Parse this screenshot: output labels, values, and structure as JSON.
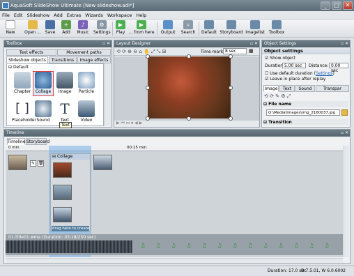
{
  "window": {
    "title": "AquaSoft SlideShow Ultimate [New slideshow.adi*]",
    "minimize": "_",
    "maximize": "□",
    "close": "✕"
  },
  "menu": [
    "File",
    "Edit",
    "Slideshow",
    "Add",
    "Extras",
    "Wizards",
    "Workspace",
    "Help"
  ],
  "toolbar": {
    "new": "New",
    "open": "Open ...",
    "save": "Save",
    "add": "Add",
    "music": "Music",
    "settings": "Settings",
    "play": "Play",
    "from_here": "... from here",
    "output": "Output",
    "search": "Search",
    "default": "Default",
    "storyboard": "Storyboard",
    "imagelist": "Imagelist",
    "toolbox": "Toolbox"
  },
  "toolbox": {
    "title": "Toolbox",
    "tabs_row1": [
      "Text effects",
      "Movement paths"
    ],
    "tabs_row2": [
      "Slideshow objects",
      "Transitions",
      "Image effects"
    ],
    "group": "Default",
    "items": [
      "Chapter",
      "Collage",
      "Image",
      "Particle",
      "Placeholder",
      "Sound",
      "Text",
      "Video"
    ],
    "tooltip": "Text"
  },
  "layout": {
    "title": "Layout Designer",
    "time_mark_label": "Time mark:",
    "time_mark_value": "8 sec"
  },
  "settings": {
    "title": "Object Settings",
    "section": "Object settings",
    "show_object": "Show object",
    "duration_label": "Duration:",
    "duration_value": "5.00 sec",
    "distance_label": "Distance:",
    "distance_value": "0.00 sec",
    "use_default": "Use default duration",
    "settings_link": "Settings",
    "leave_in_place": "Leave in place after replay",
    "tabs": [
      "Image",
      "Text",
      "Sound",
      "Transpar"
    ],
    "file_name_header": "File name",
    "file_name_value": "O:\\Media\\Images\\img_2160037.jpg",
    "transition_header": "Transition"
  },
  "timeline": {
    "title": "Timeline",
    "tabs": [
      "Timeline",
      "Storyboard"
    ],
    "ruler_start": "0 min",
    "ruler_end": "00:15 min",
    "collage_label": "Collage",
    "drag_hint": "drag here to create ...",
    "audio_label": "01-Title01.wma (Duration: 03:18/250 sec)"
  },
  "status": {
    "duration": "Duration: 17.0 sec",
    "version": "D 7.5.01, W 6.0.6002"
  },
  "colors": {
    "title_bar": "#5a6a74",
    "panel_header": "#56666f",
    "selection": "#e23a3a",
    "timeline_highlight": "#7ab0e8"
  }
}
